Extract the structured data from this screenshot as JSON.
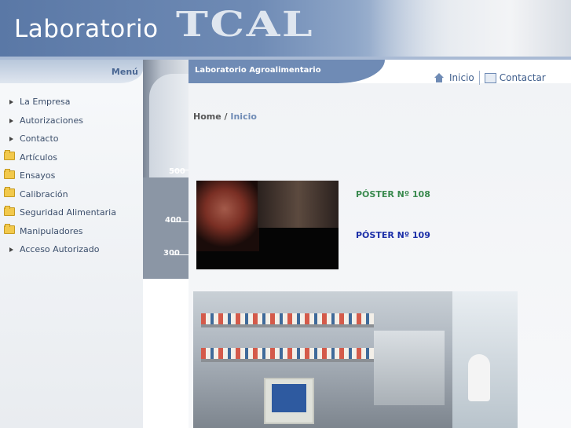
{
  "header": {
    "title_prefix": "Laboratorio",
    "brand": "TCAL"
  },
  "sidebar": {
    "menu_title": "Menú",
    "items": [
      {
        "label": "La Empresa",
        "icon": "bullet-icon"
      },
      {
        "label": "Autorizaciones",
        "icon": "bullet-icon"
      },
      {
        "label": "Contacto",
        "icon": "bullet-icon"
      },
      {
        "label": "Artículos",
        "icon": "folder-icon"
      },
      {
        "label": "Ensayos",
        "icon": "folder-icon"
      },
      {
        "label": "Calibración",
        "icon": "folder-icon"
      },
      {
        "label": "Seguridad Alimentaria",
        "icon": "folder-icon"
      },
      {
        "label": "Manipuladores",
        "icon": "folder-icon"
      },
      {
        "label": "Acceso Autorizado",
        "icon": "bullet-icon"
      }
    ]
  },
  "beaker_marks": [
    "500",
    "400",
    "300"
  ],
  "content": {
    "section_title": "Laboratorio Agroalimentario",
    "nav": {
      "home": "Inicio",
      "contact": "Contactar"
    },
    "breadcrumb": {
      "root": "Home",
      "separator": " / ",
      "current": "Inicio"
    },
    "posters": [
      {
        "label": "PÓSTER Nº 108",
        "color": "#3a8a4f"
      },
      {
        "label": "PÓSTER Nº 109",
        "color": "#1c2fa8"
      }
    ]
  },
  "colors": {
    "header_blue": "#5a78a6",
    "section_bar": "#6f8bb5",
    "menu_text": "#3b4e6b"
  }
}
